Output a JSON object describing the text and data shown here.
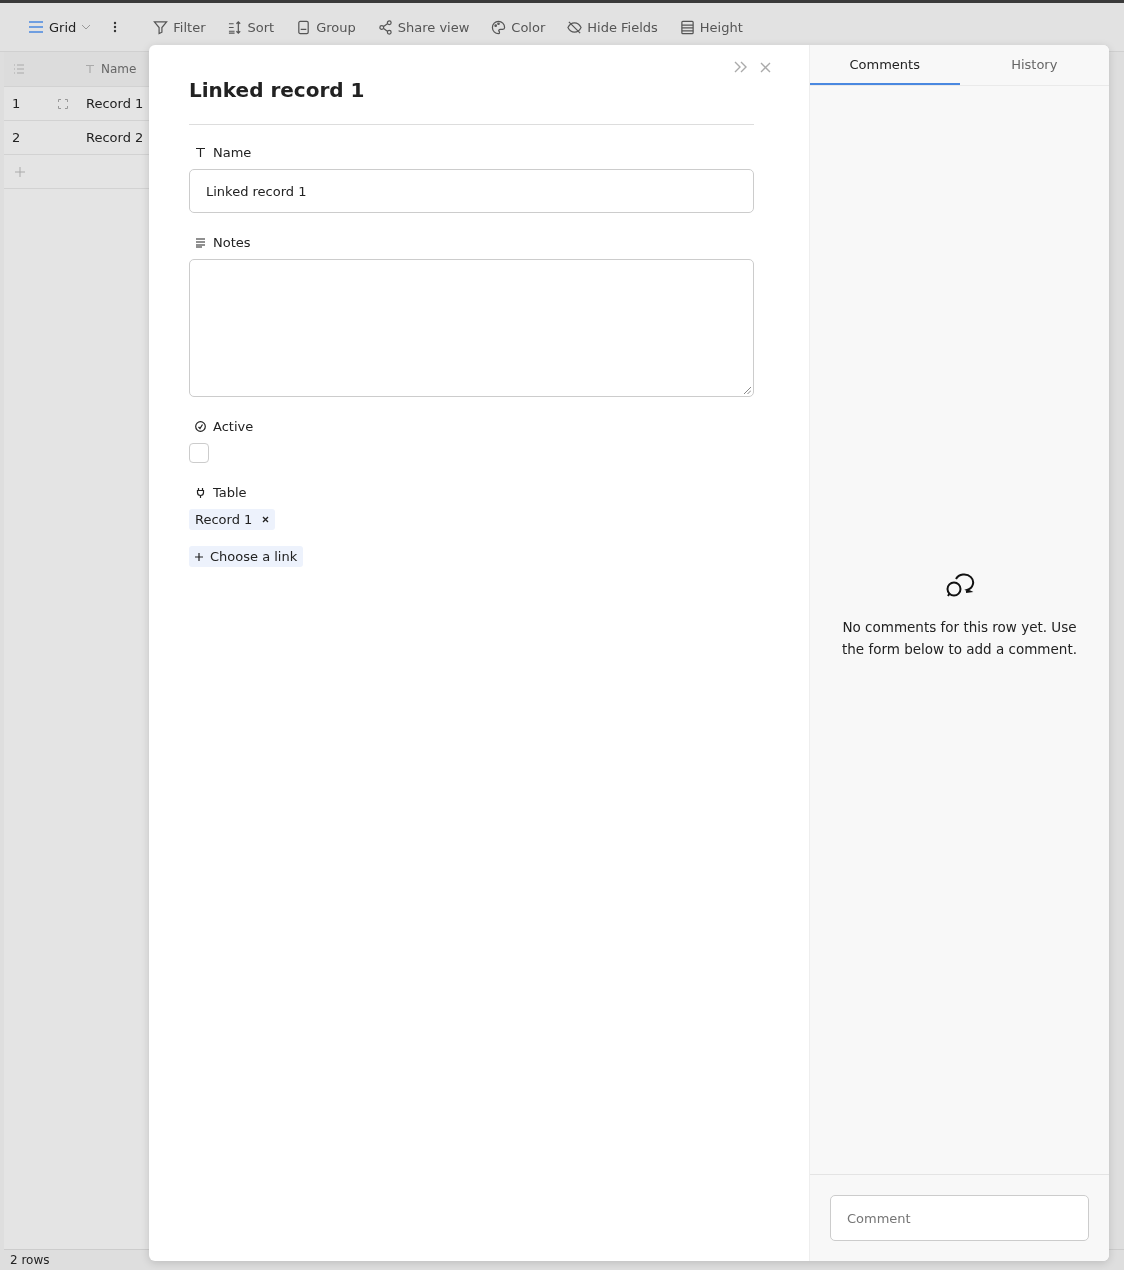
{
  "toolbar": {
    "view": "Grid",
    "items": [
      {
        "label": "Filter"
      },
      {
        "label": "Sort"
      },
      {
        "label": "Group"
      },
      {
        "label": "Share view"
      },
      {
        "label": "Color"
      },
      {
        "label": "Hide Fields"
      },
      {
        "label": "Height"
      }
    ]
  },
  "grid": {
    "column": "Name",
    "rows": [
      {
        "number": "1",
        "name": "Record 1"
      },
      {
        "number": "2",
        "name": "Record 2"
      }
    ],
    "footer": {
      "count": "2 rows"
    }
  },
  "modal": {
    "title": "Linked record 1",
    "fields": [
      {
        "kind": "text",
        "label": "Name",
        "value": "Linked record 1"
      },
      {
        "kind": "longtext",
        "label": "Notes"
      },
      {
        "kind": "checkbox",
        "label": "Active",
        "checked": false
      },
      {
        "kind": "link",
        "label": "Table",
        "links": [
          "Record 1"
        ],
        "add": "Choose a link"
      }
    ]
  },
  "side": {
    "tabs": [
      {
        "label": "Comments",
        "selected": true
      },
      {
        "label": "History",
        "selected": false
      }
    ],
    "empty_message": "No comments for this row yet. Use the form below to add a comment.",
    "comment": {
      "placeholder": "Comment"
    }
  }
}
